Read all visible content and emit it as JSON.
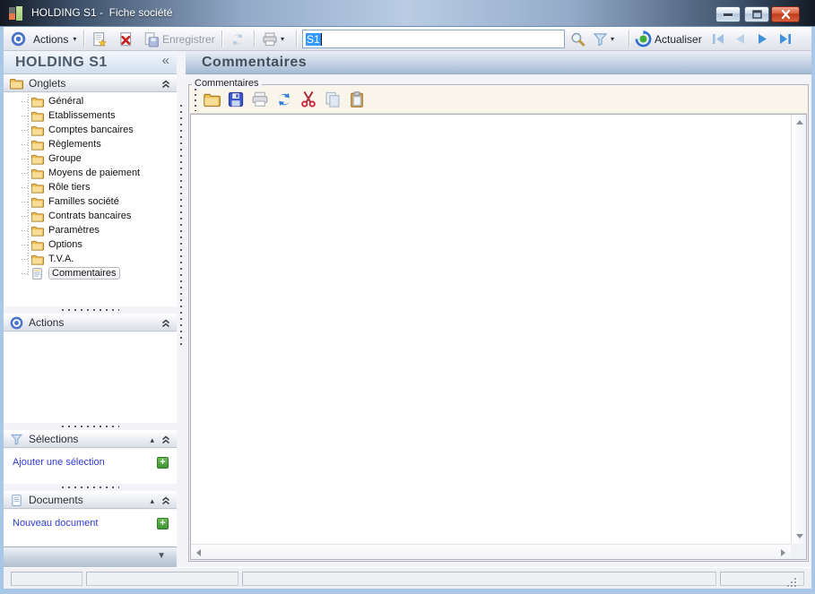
{
  "window": {
    "title": "HOLDING S1 -  Fiche société"
  },
  "toolbar": {
    "actions_label": "Actions",
    "save_label": "Enregistrer",
    "refresh_label": "Actualiser",
    "search_value": "S1"
  },
  "sidebar": {
    "title": "HOLDING S1",
    "onglets_label": "Onglets",
    "actions_label": "Actions",
    "selections_label": "Sélections",
    "documents_label": "Documents",
    "add_selection_link": "Ajouter une sélection",
    "new_document_link": "Nouveau document",
    "tree": [
      "Général",
      "Etablissements",
      "Comptes bancaires",
      "Règlements",
      "Groupe",
      "Moyens de paiement",
      "Rôle tiers",
      "Familles société",
      "Contrats bancaires",
      "Paramètres",
      "Options",
      "T.V.A.",
      "Commentaires"
    ]
  },
  "main": {
    "title": "Commentaires",
    "group_label": "Commentaires"
  },
  "icons": {
    "collapse_sidebar": "«",
    "caret_down": "▼",
    "dropdown_small": "▾",
    "section_up": "▴",
    "plus": "+",
    "bottombar_caret": "▼"
  },
  "colors": {
    "accent_blue": "#3f90dc",
    "link_blue": "#2f3bd0",
    "folder_gold": "#f0c96c",
    "close_red": "#c9402a",
    "selection_blue": "#3399ff",
    "green_plus": "#4aa23e",
    "toolbar_cream": "#f9f5ea"
  }
}
